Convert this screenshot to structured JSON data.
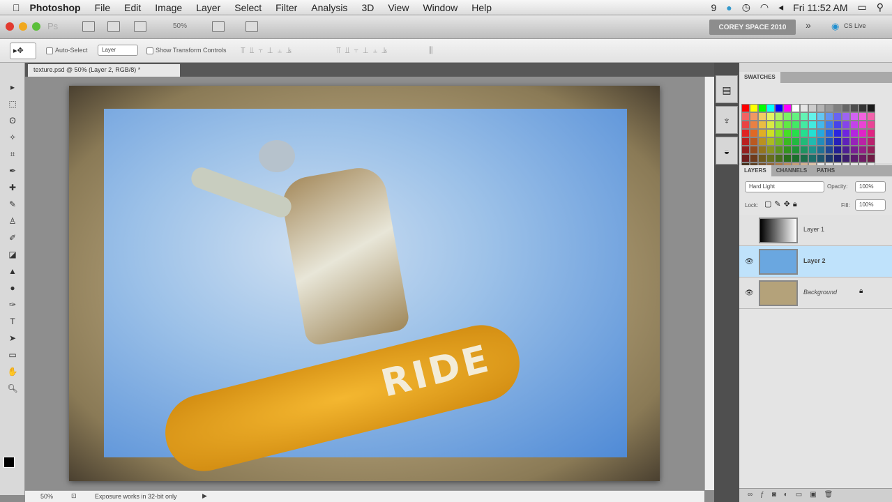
{
  "menubar": {
    "app": "Photoshop",
    "items": [
      "File",
      "Edit",
      "Image",
      "Layer",
      "Select",
      "Filter",
      "Analysis",
      "3D",
      "View",
      "Window",
      "Help"
    ],
    "status_icons": [
      "9",
      "Fri 11:52 AM"
    ]
  },
  "appbar": {
    "zoom": "50%",
    "workspace": "COREY SPACE 2010",
    "more": "»",
    "cslive": "CS Live"
  },
  "options": {
    "auto_select": "Auto-Select",
    "layer_select": "Layer",
    "show_transform": "Show Transform Controls"
  },
  "document": {
    "tab": "texture.psd @ 50% (Layer 2, RGB/8) *",
    "board_text": "RIDE"
  },
  "status": {
    "zoom": "50%",
    "message": "Exposure works in 32-bit only"
  },
  "swatches": {
    "title": "SWATCHES"
  },
  "layers": {
    "tabs": [
      "LAYERS",
      "CHANNELS",
      "PATHS"
    ],
    "blend_mode": "Hard Light",
    "opacity_label": "Opacity:",
    "opacity": "100%",
    "lock_label": "Lock:",
    "fill_label": "Fill:",
    "fill": "100%",
    "items": [
      {
        "name": "Layer 1",
        "visible": false,
        "active": false
      },
      {
        "name": "Layer 2",
        "visible": true,
        "active": true
      },
      {
        "name": "Background",
        "visible": true,
        "active": false
      }
    ]
  }
}
